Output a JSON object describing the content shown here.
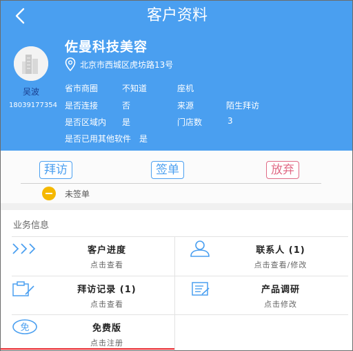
{
  "header": {
    "title": "客户资料"
  },
  "profile": {
    "store_name": "佐曼科技美容",
    "address": "北京市西城区虎坊路13号",
    "owner": "吴波",
    "phone": "18039177354",
    "info": {
      "r1c1_label": "省市商圈",
      "r1c1_value": "不知道",
      "r1c2_label": "座机",
      "r2c1_label": "是否连接",
      "r2c1_value": "否",
      "r2c2_label": "来源",
      "r2c2_value": "陌生拜访",
      "r3c1_label": "是否区域内",
      "r3c1_value": "是",
      "r3c2_label": "门店数",
      "r3c2_value": "3",
      "r4c1_label": "是否已用其他软件",
      "r4c1_value": "是"
    }
  },
  "actions": {
    "visit": "拜访",
    "sign": "签单",
    "abandon": "放弃",
    "status": "未签单"
  },
  "business": {
    "title": "业务信息",
    "cells": [
      {
        "title": "客户进度",
        "sub": "点击查看",
        "icon": "chevrons-icon"
      },
      {
        "title": "联系人 (1)",
        "sub": "点击查看/修改",
        "icon": "person-icon"
      },
      {
        "title": "拜访记录 (1)",
        "sub": "点击查看",
        "icon": "clipboard-icon"
      },
      {
        "title": "产品调研",
        "sub": "点击修改",
        "icon": "survey-icon"
      },
      {
        "title": "免费版",
        "sub": "点击注册",
        "icon": "free-icon"
      }
    ]
  },
  "colors": {
    "primary": "#4a9ff0",
    "abandon": "#e06a85",
    "status": "#f5b800",
    "accent_line": "#e8242b"
  }
}
